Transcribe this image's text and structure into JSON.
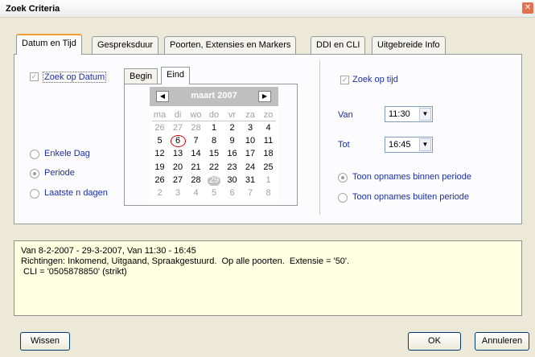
{
  "window": {
    "title": "Zoek Criteria"
  },
  "tabs": [
    "Datum en Tijd",
    "Gespreksduur",
    "Poorten, Extensies en Markers",
    "DDI en CLI",
    "Uitgebreide Info"
  ],
  "date_section": {
    "checkbox_label": "Zoek op Datum",
    "checked": true,
    "radios": [
      {
        "label": "Enkele Dag",
        "selected": false
      },
      {
        "label": "Periode",
        "selected": true
      },
      {
        "label": "Laatste n dagen",
        "selected": false
      }
    ]
  },
  "calendar": {
    "subtabs": [
      "Begin",
      "Eind"
    ],
    "active_subtab": "Eind",
    "prev_icon": "◀",
    "next_icon": "▶",
    "month": "maart 2007",
    "weekdays": [
      "ma",
      "di",
      "wo",
      "do",
      "vr",
      "za",
      "zo"
    ],
    "weeks": [
      [
        "26",
        "27",
        "28",
        "1",
        "2",
        "3",
        "4"
      ],
      [
        "5",
        "6",
        "7",
        "8",
        "9",
        "10",
        "11"
      ],
      [
        "12",
        "13",
        "14",
        "15",
        "16",
        "17",
        "18"
      ],
      [
        "19",
        "20",
        "21",
        "22",
        "23",
        "24",
        "25"
      ],
      [
        "26",
        "27",
        "28",
        "29",
        "30",
        "31",
        "1"
      ],
      [
        "2",
        "3",
        "4",
        "5",
        "6",
        "7",
        "8"
      ]
    ],
    "selected_day": "6",
    "today": "29"
  },
  "time_section": {
    "checkbox_label": "Zoek op tijd",
    "checked": true,
    "van_label": "Van",
    "van_value": "11:30",
    "tot_label": "Tot",
    "tot_value": "16:45",
    "radios": [
      {
        "label": "Toon opnames binnen periode",
        "selected": true
      },
      {
        "label": "Toon opnames buiten periode",
        "selected": false
      }
    ]
  },
  "summary": {
    "lines": [
      "Van 8-2-2007 - 29-3-2007, Van 11:30 - 16:45",
      "Richtingen: Inkomend, Uitgaand, Spraakgestuurd.  Op alle poorten.  Extensie = '50'.",
      " CLI = '0505878850' (strikt)"
    ]
  },
  "buttons": {
    "clear": "Wissen",
    "ok": "OK",
    "cancel": "Annuleren"
  },
  "colors": {
    "link_text": "#1c2ea4",
    "summary_bg": "#ffffe1",
    "calendar_header": "#bfbfbf",
    "selected_circle": "#d00000"
  }
}
